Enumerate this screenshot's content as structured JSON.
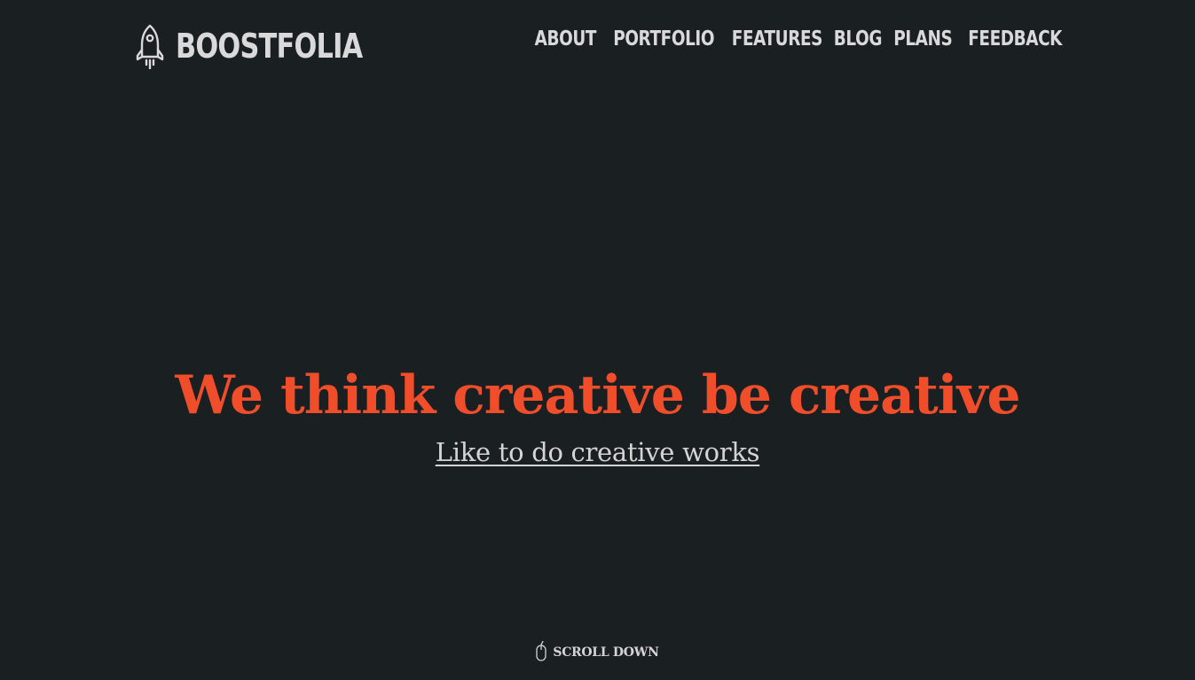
{
  "brand": {
    "name": "BOOSTFOLIA",
    "icon": "rocket-icon"
  },
  "nav": {
    "items": [
      {
        "label": "ABOUT"
      },
      {
        "label": "PORTFOLIO"
      },
      {
        "label": "FEATURES"
      },
      {
        "label": "BLOG"
      },
      {
        "label": "PLANS"
      },
      {
        "label": "FEEDBACK"
      }
    ]
  },
  "hero": {
    "title": "We think creative be creative",
    "subtitle": "Like to do creative works"
  },
  "scroll": {
    "label": "SCROLL DOWN",
    "icon": "mouse-icon"
  },
  "colors": {
    "background": "#1a1f22",
    "accent": "#f04e2a",
    "text": "#d9d9d9"
  }
}
